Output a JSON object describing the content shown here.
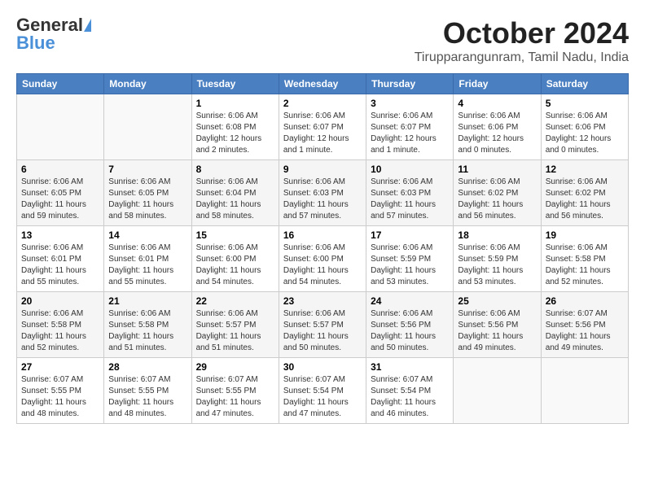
{
  "header": {
    "logo_general": "General",
    "logo_blue": "Blue",
    "month_title": "October 2024",
    "location": "Tirupparangunram, Tamil Nadu, India"
  },
  "days_of_week": [
    "Sunday",
    "Monday",
    "Tuesday",
    "Wednesday",
    "Thursday",
    "Friday",
    "Saturday"
  ],
  "weeks": [
    [
      {
        "day": "",
        "detail": ""
      },
      {
        "day": "",
        "detail": ""
      },
      {
        "day": "1",
        "detail": "Sunrise: 6:06 AM\nSunset: 6:08 PM\nDaylight: 12 hours\nand 2 minutes."
      },
      {
        "day": "2",
        "detail": "Sunrise: 6:06 AM\nSunset: 6:07 PM\nDaylight: 12 hours\nand 1 minute."
      },
      {
        "day": "3",
        "detail": "Sunrise: 6:06 AM\nSunset: 6:07 PM\nDaylight: 12 hours\nand 1 minute."
      },
      {
        "day": "4",
        "detail": "Sunrise: 6:06 AM\nSunset: 6:06 PM\nDaylight: 12 hours\nand 0 minutes."
      },
      {
        "day": "5",
        "detail": "Sunrise: 6:06 AM\nSunset: 6:06 PM\nDaylight: 12 hours\nand 0 minutes."
      }
    ],
    [
      {
        "day": "6",
        "detail": "Sunrise: 6:06 AM\nSunset: 6:05 PM\nDaylight: 11 hours\nand 59 minutes."
      },
      {
        "day": "7",
        "detail": "Sunrise: 6:06 AM\nSunset: 6:05 PM\nDaylight: 11 hours\nand 58 minutes."
      },
      {
        "day": "8",
        "detail": "Sunrise: 6:06 AM\nSunset: 6:04 PM\nDaylight: 11 hours\nand 58 minutes."
      },
      {
        "day": "9",
        "detail": "Sunrise: 6:06 AM\nSunset: 6:03 PM\nDaylight: 11 hours\nand 57 minutes."
      },
      {
        "day": "10",
        "detail": "Sunrise: 6:06 AM\nSunset: 6:03 PM\nDaylight: 11 hours\nand 57 minutes."
      },
      {
        "day": "11",
        "detail": "Sunrise: 6:06 AM\nSunset: 6:02 PM\nDaylight: 11 hours\nand 56 minutes."
      },
      {
        "day": "12",
        "detail": "Sunrise: 6:06 AM\nSunset: 6:02 PM\nDaylight: 11 hours\nand 56 minutes."
      }
    ],
    [
      {
        "day": "13",
        "detail": "Sunrise: 6:06 AM\nSunset: 6:01 PM\nDaylight: 11 hours\nand 55 minutes."
      },
      {
        "day": "14",
        "detail": "Sunrise: 6:06 AM\nSunset: 6:01 PM\nDaylight: 11 hours\nand 55 minutes."
      },
      {
        "day": "15",
        "detail": "Sunrise: 6:06 AM\nSunset: 6:00 PM\nDaylight: 11 hours\nand 54 minutes."
      },
      {
        "day": "16",
        "detail": "Sunrise: 6:06 AM\nSunset: 6:00 PM\nDaylight: 11 hours\nand 54 minutes."
      },
      {
        "day": "17",
        "detail": "Sunrise: 6:06 AM\nSunset: 5:59 PM\nDaylight: 11 hours\nand 53 minutes."
      },
      {
        "day": "18",
        "detail": "Sunrise: 6:06 AM\nSunset: 5:59 PM\nDaylight: 11 hours\nand 53 minutes."
      },
      {
        "day": "19",
        "detail": "Sunrise: 6:06 AM\nSunset: 5:58 PM\nDaylight: 11 hours\nand 52 minutes."
      }
    ],
    [
      {
        "day": "20",
        "detail": "Sunrise: 6:06 AM\nSunset: 5:58 PM\nDaylight: 11 hours\nand 52 minutes."
      },
      {
        "day": "21",
        "detail": "Sunrise: 6:06 AM\nSunset: 5:58 PM\nDaylight: 11 hours\nand 51 minutes."
      },
      {
        "day": "22",
        "detail": "Sunrise: 6:06 AM\nSunset: 5:57 PM\nDaylight: 11 hours\nand 51 minutes."
      },
      {
        "day": "23",
        "detail": "Sunrise: 6:06 AM\nSunset: 5:57 PM\nDaylight: 11 hours\nand 50 minutes."
      },
      {
        "day": "24",
        "detail": "Sunrise: 6:06 AM\nSunset: 5:56 PM\nDaylight: 11 hours\nand 50 minutes."
      },
      {
        "day": "25",
        "detail": "Sunrise: 6:06 AM\nSunset: 5:56 PM\nDaylight: 11 hours\nand 49 minutes."
      },
      {
        "day": "26",
        "detail": "Sunrise: 6:07 AM\nSunset: 5:56 PM\nDaylight: 11 hours\nand 49 minutes."
      }
    ],
    [
      {
        "day": "27",
        "detail": "Sunrise: 6:07 AM\nSunset: 5:55 PM\nDaylight: 11 hours\nand 48 minutes."
      },
      {
        "day": "28",
        "detail": "Sunrise: 6:07 AM\nSunset: 5:55 PM\nDaylight: 11 hours\nand 48 minutes."
      },
      {
        "day": "29",
        "detail": "Sunrise: 6:07 AM\nSunset: 5:55 PM\nDaylight: 11 hours\nand 47 minutes."
      },
      {
        "day": "30",
        "detail": "Sunrise: 6:07 AM\nSunset: 5:54 PM\nDaylight: 11 hours\nand 47 minutes."
      },
      {
        "day": "31",
        "detail": "Sunrise: 6:07 AM\nSunset: 5:54 PM\nDaylight: 11 hours\nand 46 minutes."
      },
      {
        "day": "",
        "detail": ""
      },
      {
        "day": "",
        "detail": ""
      }
    ]
  ]
}
